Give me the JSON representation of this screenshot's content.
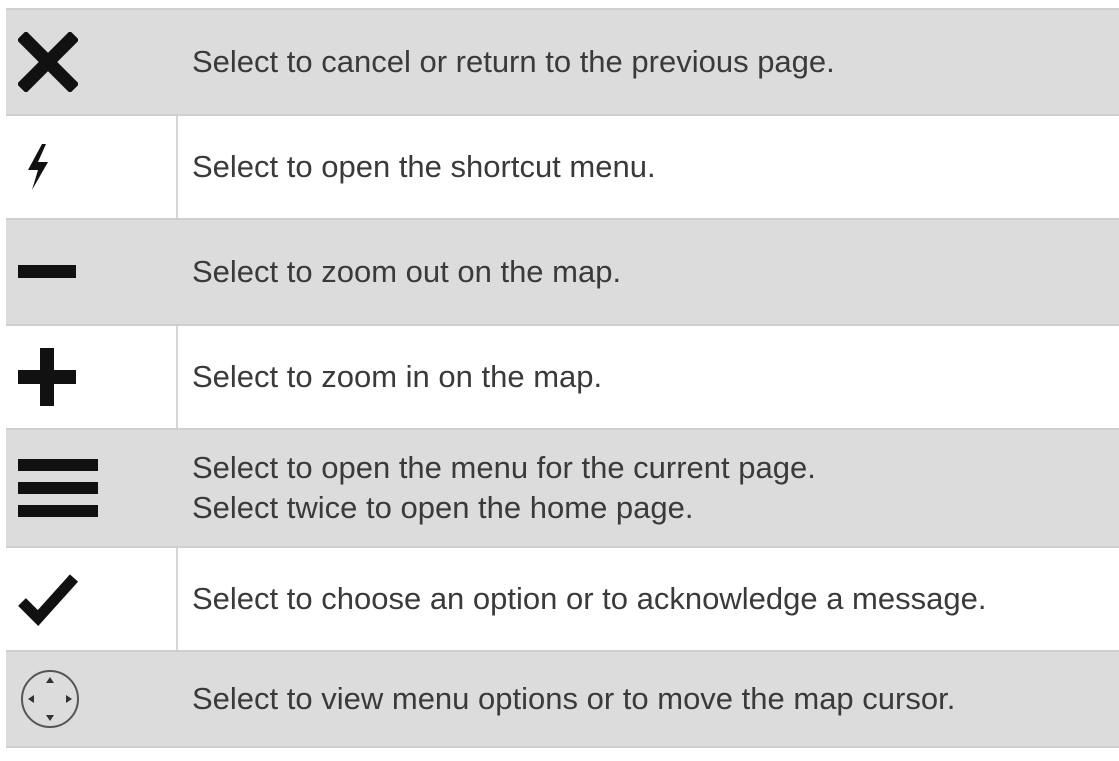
{
  "rows": [
    {
      "icon": "close-icon",
      "lines": [
        "Select to cancel or return to the previous page."
      ]
    },
    {
      "icon": "shortcut-bolt-icon",
      "lines": [
        "Select to open the shortcut menu."
      ]
    },
    {
      "icon": "minus-icon",
      "lines": [
        "Select to zoom out on the map."
      ]
    },
    {
      "icon": "plus-icon",
      "lines": [
        "Select to zoom in on the map."
      ]
    },
    {
      "icon": "menu-icon",
      "lines": [
        "Select to open the menu for the current page.",
        "Select twice to open the home page."
      ]
    },
    {
      "icon": "checkmark-icon",
      "lines": [
        "Select to choose an option or to acknowledge a message."
      ]
    },
    {
      "icon": "directional-pad-icon",
      "lines": [
        "Select to view menu options or to move the map cursor."
      ]
    }
  ],
  "colors": {
    "shaded_row": "#dcdcdc",
    "plain_row": "#ffffff",
    "text": "#3a3a3a",
    "icon": "#111111"
  }
}
